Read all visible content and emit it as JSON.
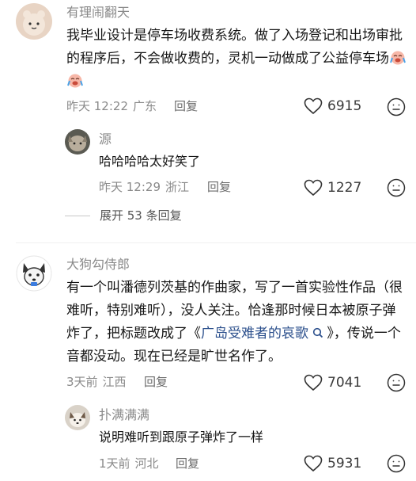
{
  "comments": [
    {
      "username": "有理闹翻天",
      "text_before": "我毕业设计是停车场收费系统。做了入场登记和出场审批的程序后，不会做收费的，灵机一动做成了公益停车场",
      "emoji": [
        "crying-laugh-emoji",
        "crying-laugh-emoji"
      ],
      "time": "昨天 12:22",
      "location": "广东",
      "reply_label": "回复",
      "likes": "6915",
      "replies": [
        {
          "username": "源",
          "text": "哈哈哈哈太好笑了",
          "time": "昨天 12:29",
          "location": "浙江",
          "reply_label": "回复",
          "likes": "1227"
        }
      ],
      "expand_label": "展开 53 条回复"
    },
    {
      "username": "大狗勾侍郎",
      "text_before": "有一个叫潘德列茨基的作曲家，写了一首实验性作品（很难听，特别难听），没人关注。恰逢那时候日本被原子弹炸了，把标题改成了《",
      "link_text": "广岛受难者的哀歌",
      "text_after": "》，传说一个音都没动。现在已经是旷世名作了。",
      "time": "3天前",
      "location": "江西",
      "reply_label": "回复",
      "likes": "7041",
      "replies": [
        {
          "username": "扑满满满",
          "text": "说明难听到跟原子弹炸了一样",
          "time": "1天前",
          "location": "河北",
          "reply_label": "回复",
          "likes": "5931"
        }
      ]
    }
  ],
  "colors": {
    "meta_gray": "#8a8a8a",
    "link_blue": "#2b4f8c",
    "text": "#161616"
  }
}
